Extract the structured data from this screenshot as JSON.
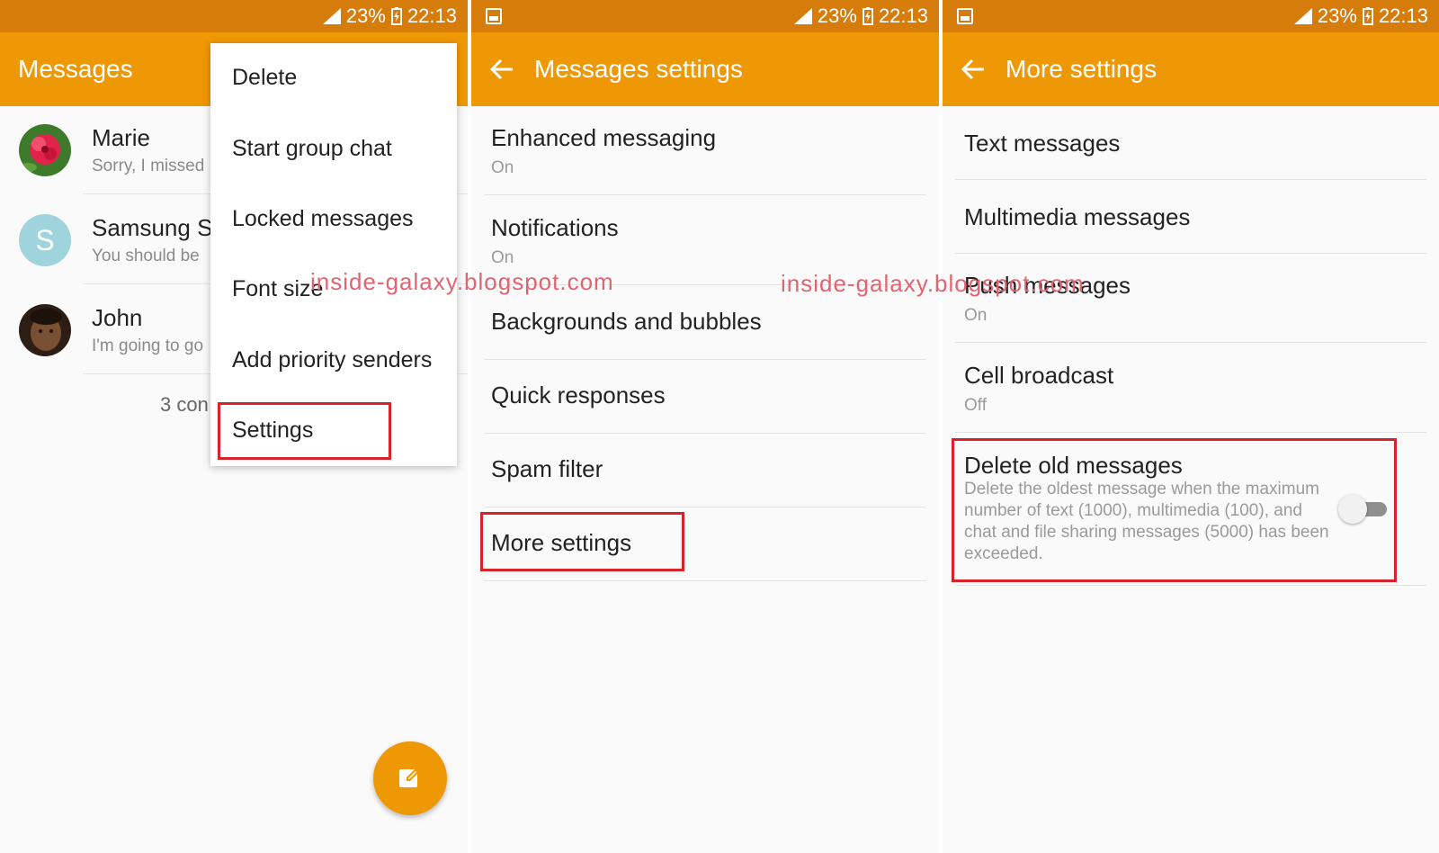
{
  "status": {
    "battery": "23%",
    "time": "22:13"
  },
  "colors": {
    "status_bar": "#d57c0a",
    "app_bar": "#ef9806",
    "highlight": "#d8232a",
    "watermark": "#e26470"
  },
  "panel1": {
    "title": "Messages",
    "conversations": [
      {
        "name": "Marie",
        "preview": "Sorry, I missed",
        "avatar": "flower-photo"
      },
      {
        "name": "Samsung S",
        "preview": "You should be",
        "avatar_letter": "S"
      },
      {
        "name": "John",
        "preview": "I'm going to go",
        "avatar": "person-photo"
      }
    ],
    "count_text": "3 con",
    "menu": [
      "Delete",
      "Start group chat",
      "Locked messages",
      "Font size",
      "Add priority senders",
      "Settings"
    ],
    "fab_icon": "compose-icon"
  },
  "panel2": {
    "title": "Messages settings",
    "items": [
      {
        "title": "Enhanced messaging",
        "sub": "On"
      },
      {
        "title": "Notifications",
        "sub": "On"
      },
      {
        "title": "Backgrounds and bubbles"
      },
      {
        "title": "Quick responses"
      },
      {
        "title": "Spam filter"
      },
      {
        "title": "More settings"
      }
    ]
  },
  "panel3": {
    "title": "More settings",
    "items": [
      {
        "title": "Text messages"
      },
      {
        "title": "Multimedia messages"
      },
      {
        "title": "Push messages",
        "sub": "On"
      },
      {
        "title": "Cell broadcast",
        "sub": "Off"
      },
      {
        "title": "Delete old messages",
        "desc": "Delete the oldest message when the maximum number of text (1000), multimedia (100), and chat and file sharing messages (5000) has been exceeded.",
        "toggle_on": false
      }
    ]
  },
  "watermarks": [
    "inside-galaxy.blogspot.com",
    "inside-galaxy.blogspot.com"
  ]
}
